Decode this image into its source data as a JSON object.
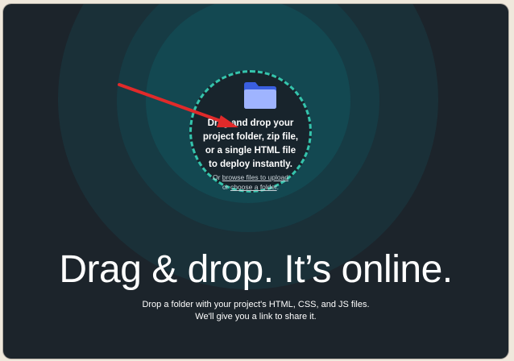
{
  "colors": {
    "background": "#1c242b",
    "ring_accent": "#35c4ac",
    "arrow": "#e02a2a",
    "folder": "#9fb4ff",
    "text": "#ffffff"
  },
  "dropzone": {
    "icon": "folder-icon",
    "line1": "Drag and drop your",
    "line2": "project folder, zip file,",
    "line3": "or a single HTML file",
    "line4": "to deploy instantly.",
    "or1": "Or",
    "browse_link": "browse files to upload",
    "or2": "or",
    "choose_folder_link": "choose a folder",
    "choose_folder_suffix": "."
  },
  "headline": "Drag & drop. It’s online.",
  "subtext": {
    "line1": "Drop a folder with your project's HTML, CSS, and JS files.",
    "line2": "We'll give you a link to share it."
  }
}
